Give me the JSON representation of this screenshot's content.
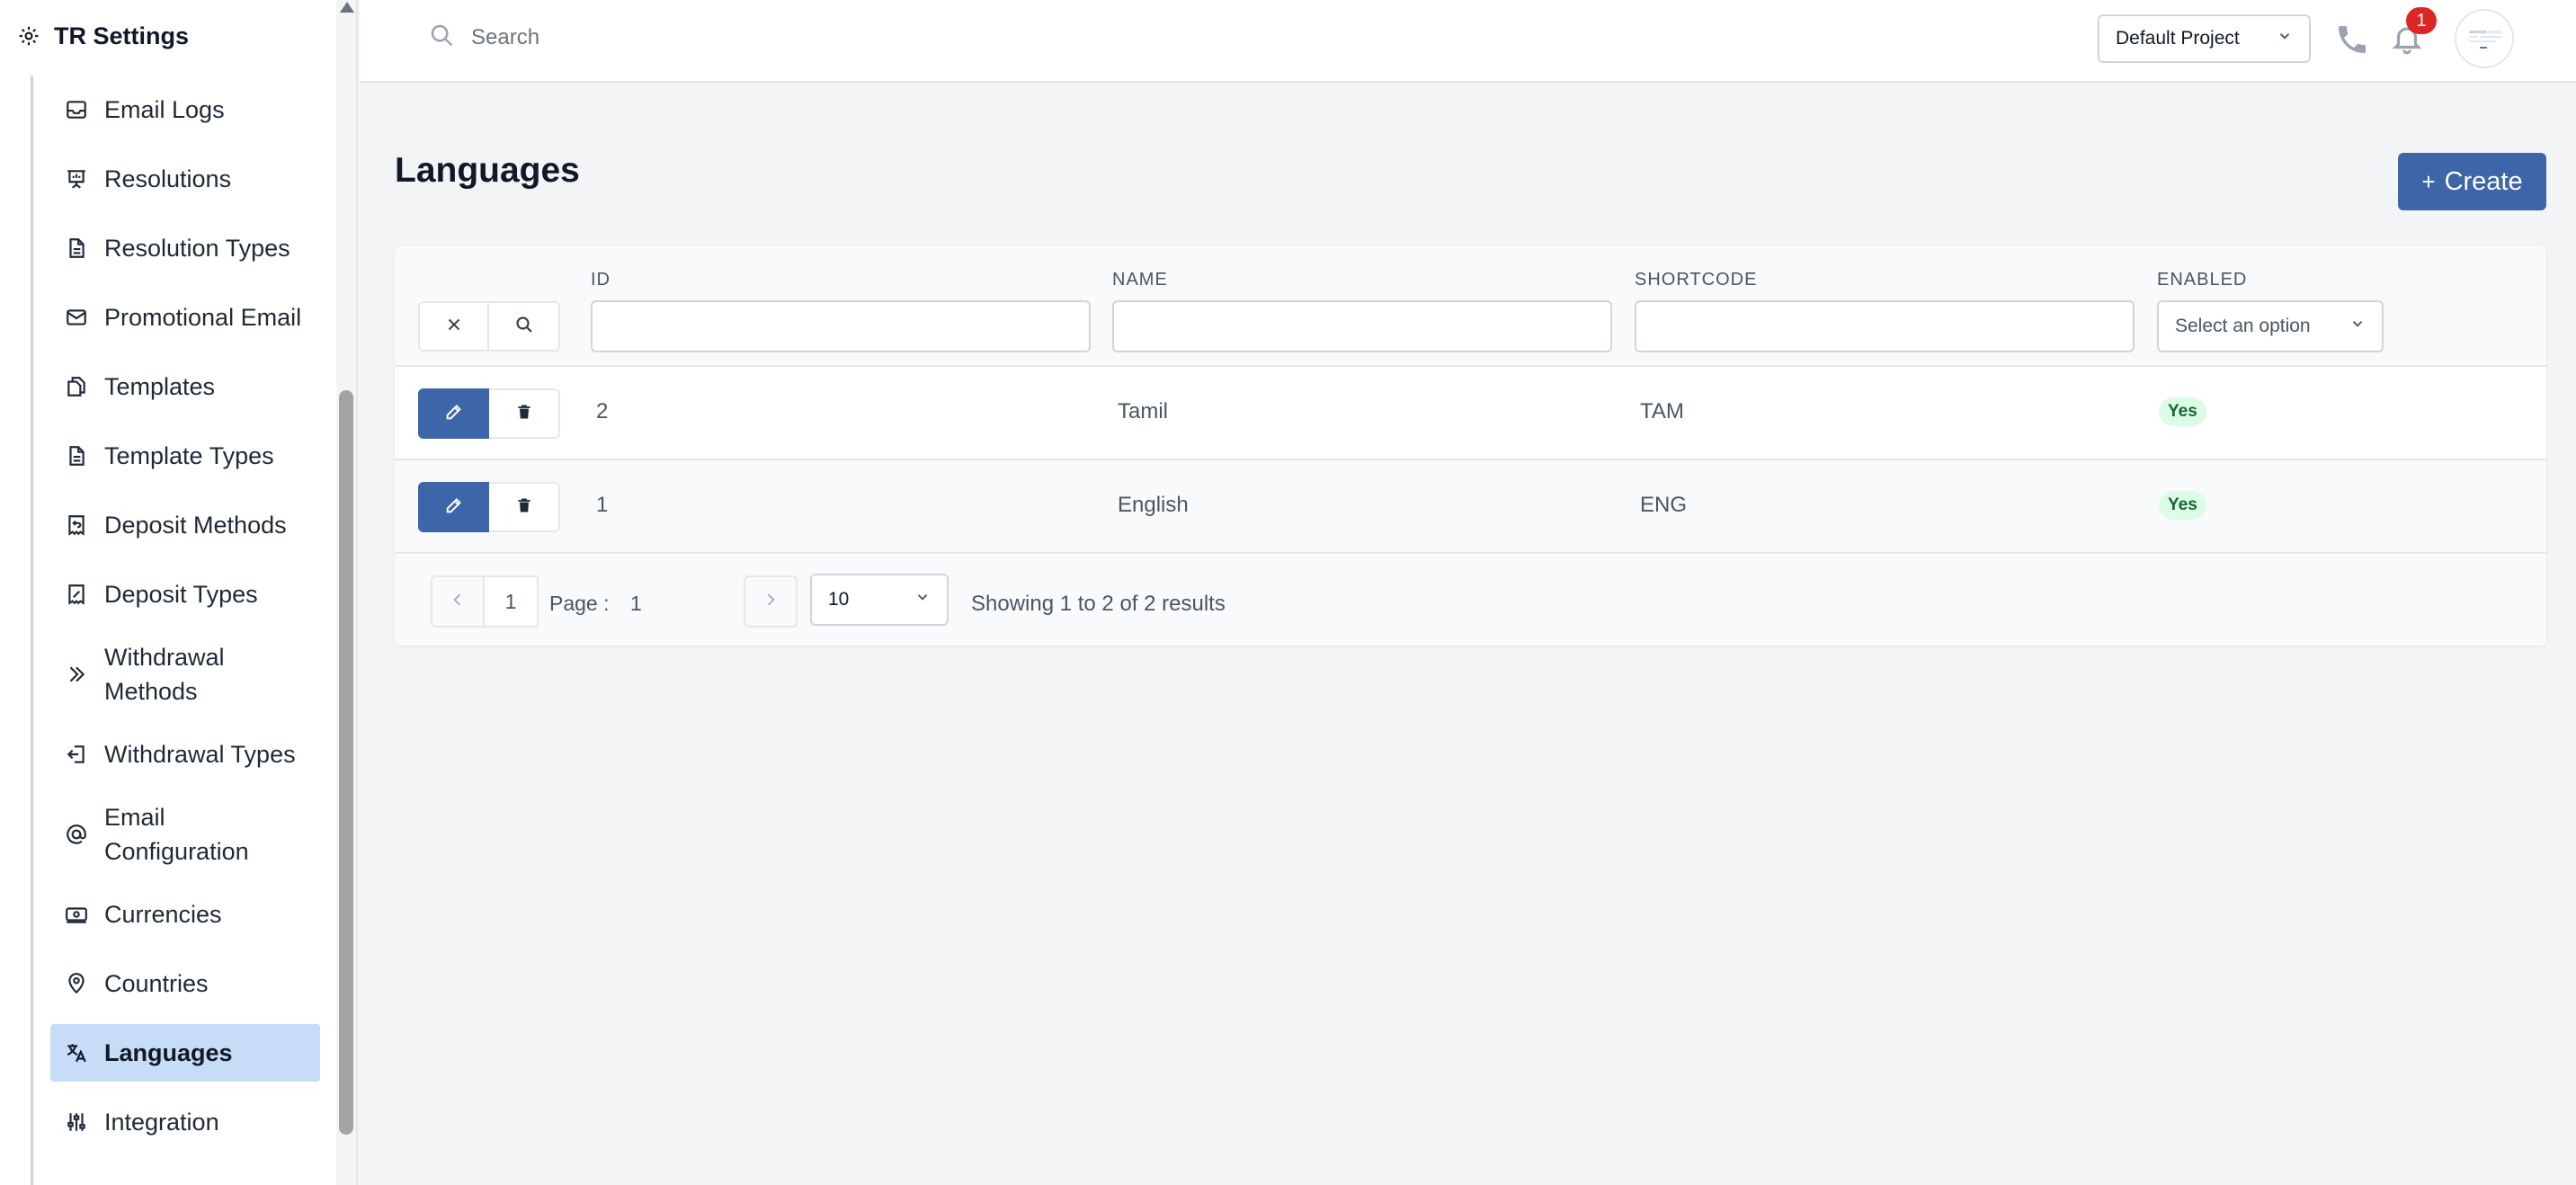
{
  "sidebar": {
    "title": "TR Settings",
    "title_icon": "gear-icon",
    "items": [
      {
        "label": "Email Logs",
        "icon": "inbox-icon"
      },
      {
        "label": "Resolutions",
        "icon": "presentation-icon"
      },
      {
        "label": "Resolution Types",
        "icon": "document-icon"
      },
      {
        "label": "Promotional Email",
        "icon": "mail-icon"
      },
      {
        "label": "Templates",
        "icon": "documents-icon"
      },
      {
        "label": "Template Types",
        "icon": "document-icon"
      },
      {
        "label": "Deposit Methods",
        "icon": "receipt-refund-icon"
      },
      {
        "label": "Deposit Types",
        "icon": "receipt-percent-icon"
      },
      {
        "label": "Withdrawal Methods",
        "icon": "chevron-double-right-icon"
      },
      {
        "label": "Withdrawal Types",
        "icon": "arrow-left-on-rectangle-icon"
      },
      {
        "label": "Email Configuration",
        "icon": "at-symbol-icon"
      },
      {
        "label": "Currencies",
        "icon": "banknotes-icon"
      },
      {
        "label": "Countries",
        "icon": "map-pin-icon"
      },
      {
        "label": "Languages",
        "icon": "language-icon",
        "active": true
      },
      {
        "label": "Integration",
        "icon": "sliders-icon"
      }
    ]
  },
  "topbar": {
    "search_placeholder": "Search",
    "project": "Default Project",
    "notification_count": "1"
  },
  "page": {
    "title": "Languages",
    "create_label": "Create"
  },
  "table": {
    "columns": [
      "ID",
      "NAME",
      "SHORTCODE",
      "ENABLED"
    ],
    "enabled_placeholder": "Select an option",
    "rows": [
      {
        "id": "2",
        "name": "Tamil",
        "shortcode": "TAM",
        "enabled": "Yes"
      },
      {
        "id": "1",
        "name": "English",
        "shortcode": "ENG",
        "enabled": "Yes"
      }
    ]
  },
  "pagination": {
    "current_page": "1",
    "page_label": "Page :",
    "page_value": "1",
    "page_size": "10",
    "summary": "Showing 1 to 2 of 2 results"
  },
  "colors": {
    "primary": "#3d66a8",
    "active_nav": "#c7dcf7",
    "badge": "#dc2626",
    "enabled_pill": "#dcfce7"
  }
}
